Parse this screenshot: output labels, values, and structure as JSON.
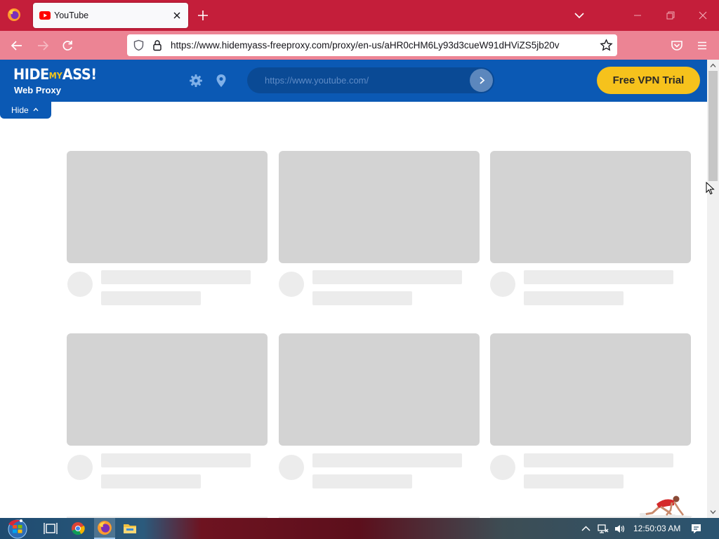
{
  "browser": {
    "tab_title": "YouTube",
    "url": "https://www.hidemyass-freeproxy.com/proxy/en-us/aHR0cHM6Ly93d3cueW91dHViZS5jb20v"
  },
  "proxy": {
    "logo_hide": "HIDE",
    "logo_my": "MY",
    "logo_ass": "ASS!",
    "subtitle": "Web Proxy",
    "url_value": "https://www.youtube.com/",
    "vpn_button": "Free VPN Trial",
    "hide_label": "Hide"
  },
  "taskbar": {
    "clock": "12:50:03 AM"
  },
  "icons": {
    "firefox": "firefox-icon",
    "youtube": "youtube-favicon",
    "settings": "gear-icon",
    "location": "location-pin-icon",
    "pocket": "pocket-icon",
    "menu": "hamburger-menu-icon"
  },
  "colors": {
    "titlebar": "#c41e3a",
    "navbar": "#ec8494",
    "proxy_header": "#0b59b4",
    "vpn_button": "#f6c21c",
    "skeleton_thumb": "#d3d3d3",
    "skeleton_line": "#ececec"
  }
}
